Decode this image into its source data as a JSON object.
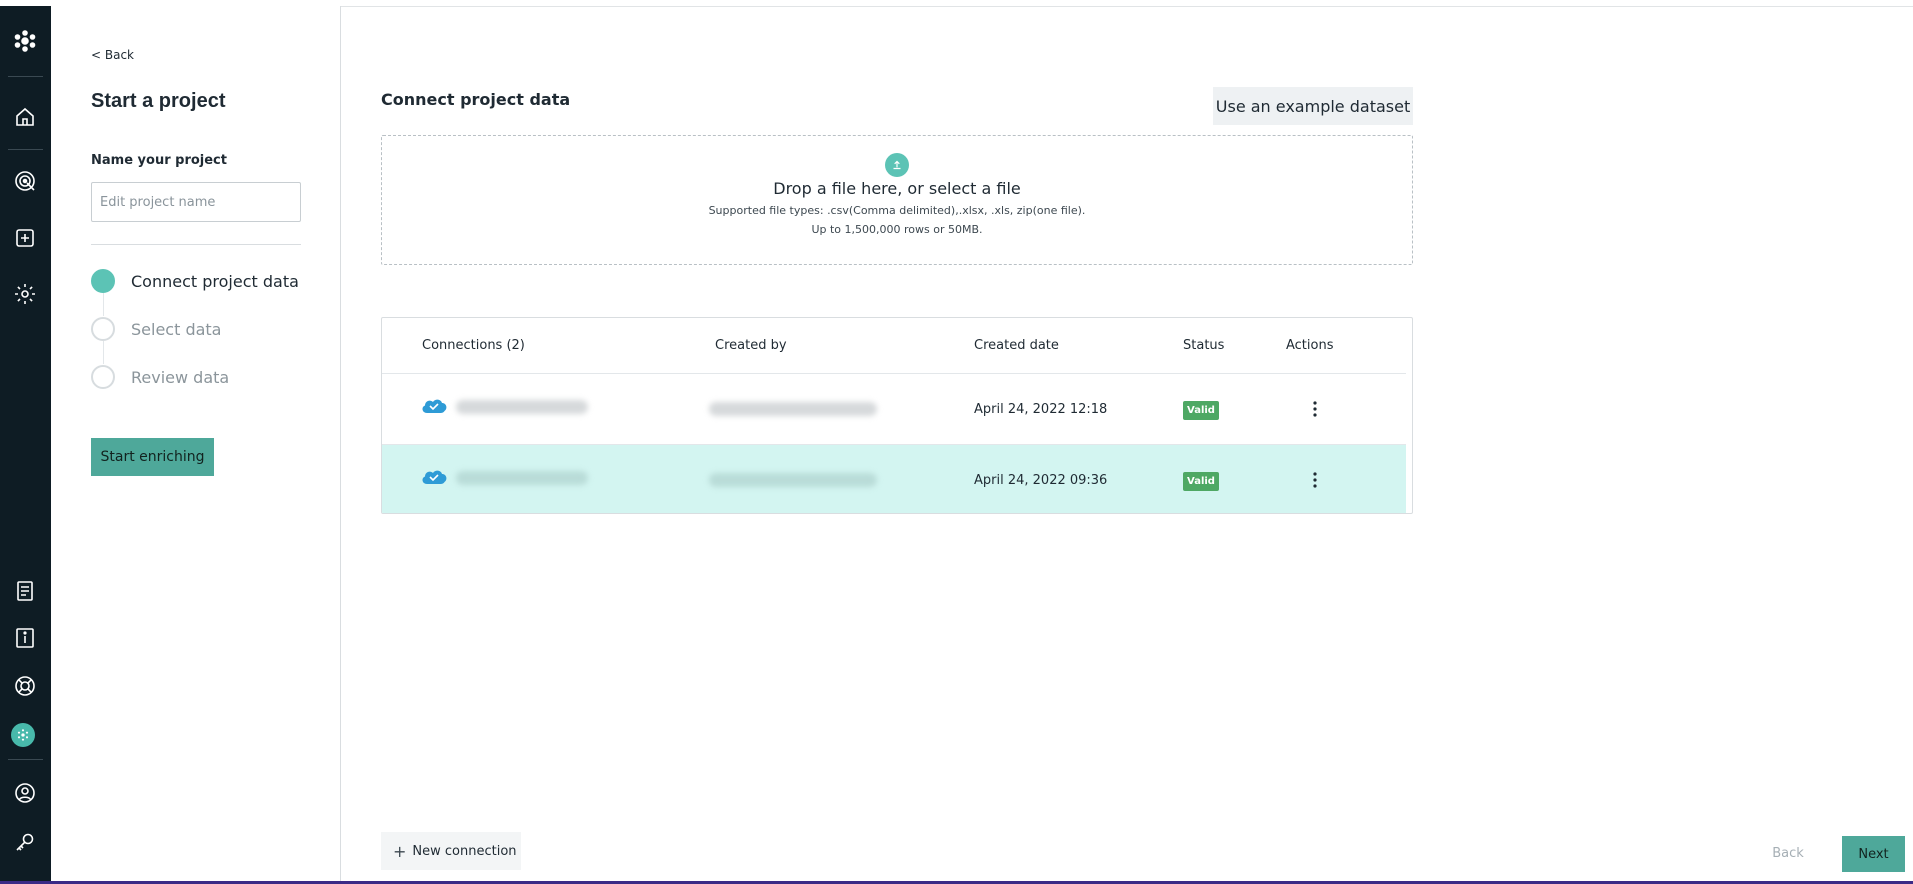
{
  "nav_rail": {
    "items": [
      {
        "icon": "logo-icon"
      },
      {
        "icon": "home-icon"
      },
      {
        "icon": "target-icon"
      },
      {
        "icon": "add-project-icon"
      },
      {
        "icon": "settings-gear-icon"
      },
      {
        "icon": "document-list-icon"
      },
      {
        "icon": "info-book-icon"
      },
      {
        "icon": "help-lifebuoy-icon"
      },
      {
        "icon": "org-avatar-icon"
      },
      {
        "icon": "user-profile-icon"
      },
      {
        "icon": "key-icon"
      }
    ]
  },
  "side_panel": {
    "back_label": "< Back",
    "title": "Start a project",
    "name_label": "Name your project",
    "name_value": "",
    "name_placeholder": "Edit project name",
    "steps": [
      {
        "label": "Connect project data",
        "active": true
      },
      {
        "label": "Select data",
        "active": false
      },
      {
        "label": "Review data",
        "active": false
      }
    ],
    "start_button_label": "Start enriching"
  },
  "main": {
    "section_title": "Connect project data",
    "example_button_label": "Use an example dataset",
    "dropzone": {
      "title": "Drop a file here, or select a file",
      "supported_types": "Supported file types: .csv(Comma delimited),.xlsx, .xls, zip(one file).",
      "limit": "Up to 1,500,000 rows or 50MB."
    },
    "table": {
      "headers": [
        "Connections (2)",
        "Created by",
        "Created date",
        "Status",
        "Actions"
      ],
      "rows": [
        {
          "created_date": "April 24, 2022 12:18",
          "status": "Valid",
          "highlighted": false
        },
        {
          "created_date": "April 24, 2022 09:36",
          "status": "Valid",
          "highlighted": true
        }
      ]
    },
    "new_connection_label": "New connection",
    "back_button_label": "Back",
    "next_button_label": "Next"
  },
  "colors": {
    "rail": "#0e1c24",
    "accent": "#5cc3b5",
    "primary_button": "#4ea89a",
    "valid_badge": "#4ea864",
    "row_highlight": "#d3f5f1"
  }
}
